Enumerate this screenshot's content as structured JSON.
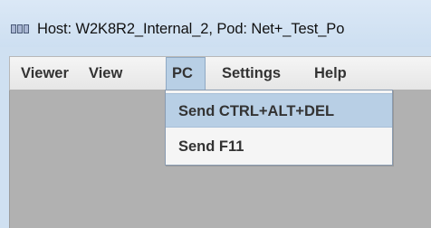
{
  "window": {
    "title": "Host: W2K8R2_Internal_2, Pod: Net+_Test_Po",
    "icon": "remote-desktop-icon"
  },
  "menubar": {
    "items": [
      {
        "label": "Viewer"
      },
      {
        "label": "View"
      },
      {
        "label": "PC"
      },
      {
        "label": "Settings"
      },
      {
        "label": "Help"
      }
    ],
    "active": "PC"
  },
  "pc_menu": {
    "items": [
      {
        "label": "Send CTRL+ALT+DEL",
        "highlighted": true
      },
      {
        "label": "Send F11",
        "highlighted": false
      }
    ]
  },
  "colors": {
    "titlebar": "#cfe0f1",
    "menu_highlight": "#b8cfe5",
    "content_area": "#b1b1b1"
  }
}
